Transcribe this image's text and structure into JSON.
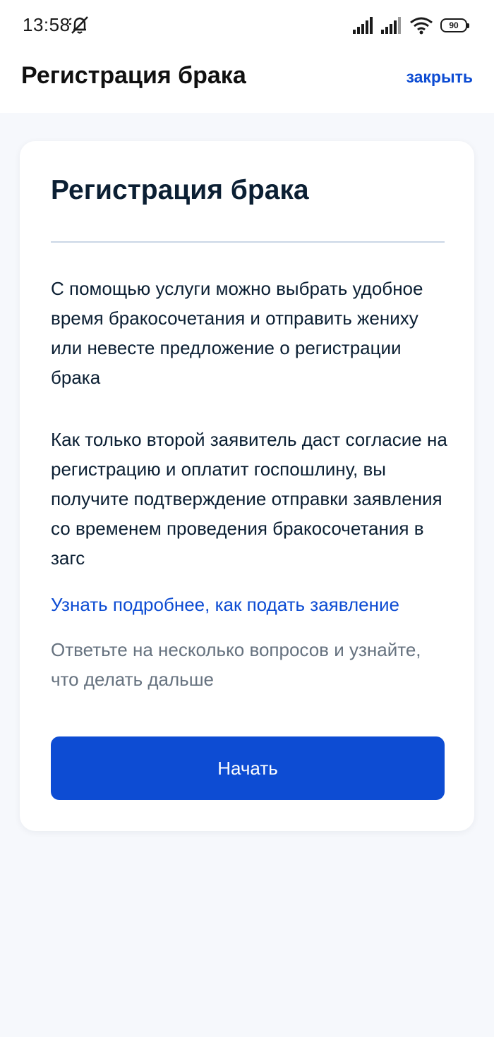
{
  "status_bar": {
    "time": "13:58",
    "battery": "90"
  },
  "header": {
    "title": "Регистрация брака",
    "close_label": "закрыть"
  },
  "card": {
    "title": "Регистрация брака",
    "paragraph_1": "С помощью услуги можно выбрать удобное время бракосочетания и отправить жениху или невесте предложение о регистрации брака",
    "paragraph_2": "Как только второй заявитель даст согласие на регистрацию и оплатит госпошлину, вы получите подтверждение отправки заявления со временем проведения бракосочетания в загс",
    "more_link": "Узнать подробнее, как подать заявление",
    "hint": "Ответьте на несколько вопросов и узнайте, что делать дальше",
    "start_button": "Начать"
  },
  "colors": {
    "accent": "#0d4cd3",
    "background": "#f6f8fc",
    "text": "#0b1f33",
    "muted": "#66727f"
  },
  "icons": {
    "mute": "bell-off-icon",
    "signal": "signal-icon",
    "wifi": "wifi-icon",
    "battery": "battery-icon"
  }
}
